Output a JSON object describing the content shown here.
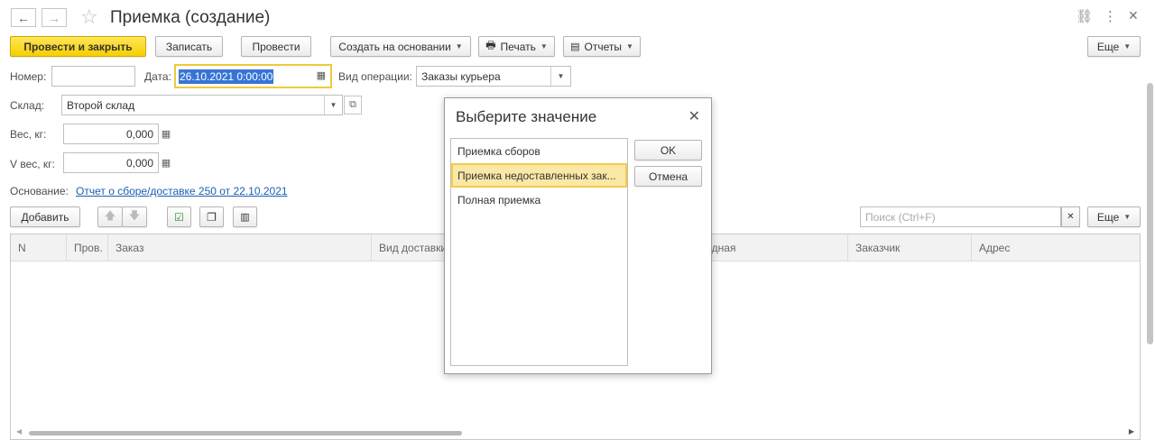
{
  "window": {
    "title": "Приемка (создание)",
    "icons": {
      "back": "arrow-left-icon",
      "forward": "arrow-right-icon",
      "favorite": "star-icon",
      "link": "link-icon",
      "menu": "kebab-menu-icon",
      "close": "close-icon"
    }
  },
  "toolbar": {
    "post_close": "Провести и закрыть",
    "save": "Записать",
    "post": "Провести",
    "create_based": "Создать на основании",
    "print": "Печать",
    "reports": "Отчеты",
    "more": "Еще"
  },
  "form": {
    "number_label": "Номер:",
    "number_value": "",
    "date_label": "Дата:",
    "date_value": "26.10.2021  0:00:00",
    "operation_label": "Вид операции:",
    "operation_value": "Заказы курьера",
    "warehouse_label": "Склад:",
    "warehouse_value": "Второй склад",
    "weight_label": "Вес, кг:",
    "weight_value": "0,000",
    "vweight_label": "V вес, кг:",
    "vweight_value": "0,000",
    "basis_label": "Основание:",
    "basis_link": "Отчет о сборе/доставке 250 от 22.10.2021"
  },
  "table_toolbar": {
    "add": "Добавить",
    "search_placeholder": "Поиск (Ctrl+F)",
    "more": "Еще"
  },
  "table": {
    "columns": [
      "N",
      "Пров.",
      "Заказ",
      "Вид доставки",
      "адная",
      "Заказчик",
      "Адрес"
    ],
    "rows": []
  },
  "dialog": {
    "title": "Выберите значение",
    "options": [
      "Приемка сборов",
      "Приемка недоставленных зак...",
      "Полная приемка"
    ],
    "selected_index": 1,
    "ok": "OK",
    "cancel": "Отмена"
  },
  "colors": {
    "primary_button": "#f5d000",
    "link": "#1a5fb4",
    "selection": "#fbe8a6",
    "date_highlight": "#3874d6"
  }
}
